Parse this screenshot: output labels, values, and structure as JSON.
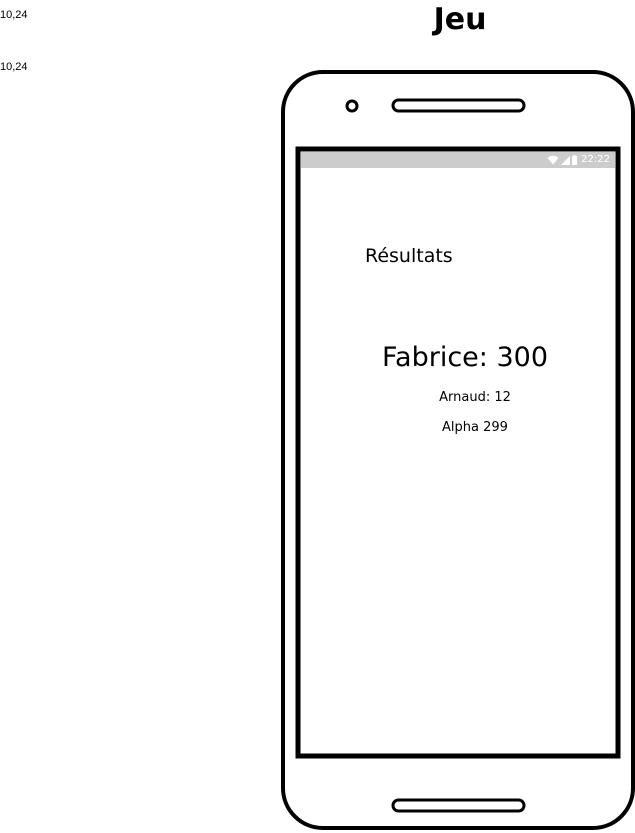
{
  "side_notes": [
    "10,24",
    "10,24"
  ],
  "page": {
    "title": "Jeu"
  },
  "status_bar": {
    "icons": [
      "wifi-icon",
      "signal-icon",
      "battery-icon"
    ],
    "time": "22:22"
  },
  "screen": {
    "heading": "Résultats",
    "top_score": "Fabrice: 300",
    "scores": [
      "Arnaud: 12",
      "Alpha 299"
    ]
  },
  "colors": {
    "status_bar_bg": "#cccccc",
    "status_icon": "#ffffff",
    "frame": "#000000"
  }
}
